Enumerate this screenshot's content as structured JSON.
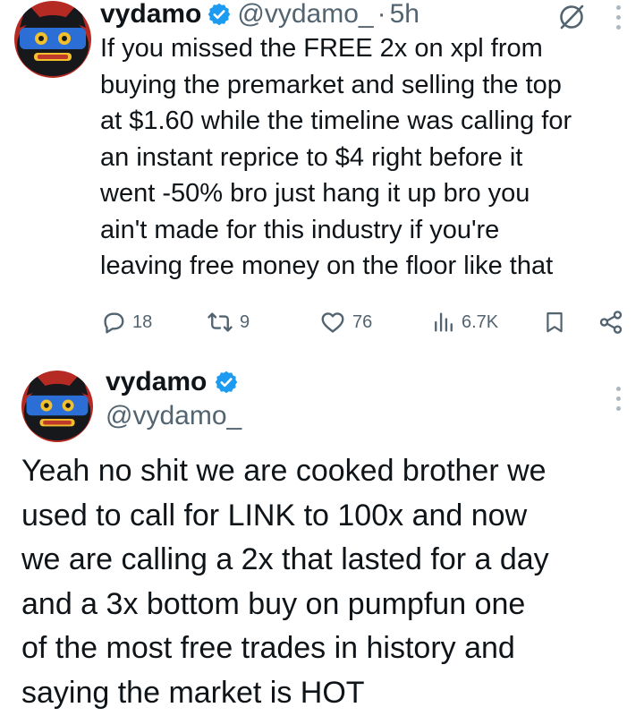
{
  "tweets": [
    {
      "author": {
        "name": "vydamo",
        "handle": "@vydamo_",
        "verified": true
      },
      "separator": "·",
      "time": "5h",
      "text": "If you missed the FREE 2x on xpl from\nbuying the premarket and selling the top\nat $1.60 while the timeline was calling for\nan instant reprice to $4 right before it\nwent -50% bro just hang it up bro you\nain't made for this industry if you're\nleaving free money on the floor like that",
      "stats": {
        "replies": "18",
        "reposts": "9",
        "likes": "76",
        "views": "6.7K"
      }
    },
    {
      "author": {
        "name": "vydamo",
        "handle": "@vydamo_",
        "verified": true
      },
      "text": "Yeah no shit we are cooked brother we\nused to call for LINK to 100x and now\nwe are calling a 2x that lasted for a day\nand a 3x bottom buy on pumpfun one\nof the most free trades in history and\nsaying the market is HOT"
    }
  ],
  "icons": {
    "reply": "reply-icon",
    "repost": "repost-icon",
    "like": "heart-icon",
    "views": "views-chart-icon",
    "bookmark": "bookmark-icon",
    "share": "share-icon",
    "grok": "grok-icon",
    "more": "more-options-icon",
    "verified": "verified-badge-icon"
  },
  "colors": {
    "text": "#0f1419",
    "secondary": "#536471",
    "verified": "#1d9bf0",
    "background": "#ffffff"
  }
}
